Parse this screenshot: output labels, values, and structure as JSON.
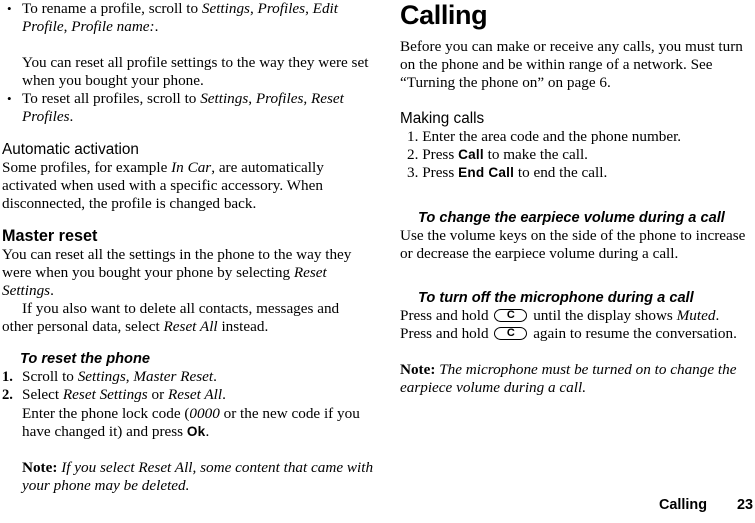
{
  "document": {
    "type": "phone-user-manual-page",
    "page_number": "23",
    "footer_chapter": "Calling"
  },
  "left_column": {
    "bullets": [
      {
        "marker": "•",
        "text_parts": [
          {
            "t": "To rename a profile, scroll to ",
            "style": "normal"
          },
          {
            "t": "Settings",
            "style": "italic"
          },
          {
            "t": ", ",
            "style": "normal"
          },
          {
            "t": "Profiles",
            "style": "italic"
          },
          {
            "t": ", ",
            "style": "normal"
          },
          {
            "t": "Edit Profile",
            "style": "italic"
          },
          {
            "t": ", ",
            "style": "normal"
          },
          {
            "t": "Profile name:",
            "style": "italic"
          },
          {
            "t": ".",
            "style": "normal"
          }
        ]
      }
    ],
    "intro_paragraph": "You can reset all profile settings to the way they were set when you bought your phone.",
    "bullet2": {
      "marker": "•",
      "text_parts": [
        {
          "t": "To reset all profiles, scroll to ",
          "style": "normal"
        },
        {
          "t": "Settings",
          "style": "italic"
        },
        {
          "t": ", ",
          "style": "normal"
        },
        {
          "t": "Profiles",
          "style": "italic"
        },
        {
          "t": ", ",
          "style": "normal"
        },
        {
          "t": "Reset Profiles",
          "style": "italic"
        },
        {
          "t": ".",
          "style": "normal"
        }
      ]
    },
    "automatic_activation": {
      "heading": "Automatic activation",
      "body_pre": "Some profiles, for example ",
      "body_italic": "In Car",
      "body_post": ", are automatically activated when used with a specific accessory. When disconnected, the profile is changed back."
    },
    "master_reset": {
      "heading": "Master reset",
      "body_pre": "You can reset all the settings in the phone to the way they were when you bought your phone by selecting ",
      "body_italic": "Reset Settings",
      "body_post": ".",
      "body2_pre": "If you also want to delete all contacts, messages and other personal data, select ",
      "body2_italic": "Reset All",
      "body2_post": " instead."
    },
    "to_reset_the_phone": {
      "heading": "To reset the phone",
      "steps": [
        {
          "num": "1.",
          "parts": [
            {
              "t": "Scroll to ",
              "style": "normal"
            },
            {
              "t": "Settings",
              "style": "italic"
            },
            {
              "t": ", ",
              "style": "normal"
            },
            {
              "t": "Master Reset",
              "style": "italic"
            },
            {
              "t": ".",
              "style": "normal"
            }
          ]
        },
        {
          "num": "2.",
          "parts": [
            {
              "t": "Select ",
              "style": "normal"
            },
            {
              "t": "Reset Settings",
              "style": "italic"
            },
            {
              "t": " or ",
              "style": "normal"
            },
            {
              "t": "Reset All",
              "style": "italic"
            },
            {
              "t": ".",
              "style": "normal"
            }
          ]
        }
      ],
      "step2_continuation": {
        "pre": "Enter the phone lock code (",
        "code": "0000",
        "mid": " or the new code if you have changed it) and press ",
        "key": "Ok",
        "post": "."
      }
    },
    "note": {
      "label": "Note:",
      "text": "If you select Reset All, some content that came with your phone may be deleted."
    }
  },
  "right_column": {
    "chapter_title": "Calling",
    "intro": "Before you can make or receive any calls, you must turn on the phone and be within range of a network. See “Turning the phone on” on page 6.",
    "making_calls": {
      "heading": "Making calls",
      "steps": [
        {
          "num": "1.",
          "parts": [
            {
              "t": "Enter the area code and the phone number.",
              "style": "normal"
            }
          ]
        },
        {
          "num": "2.",
          "parts": [
            {
              "t": "Press ",
              "style": "normal"
            },
            {
              "t": "Call",
              "style": "key"
            },
            {
              "t": " to make the call.",
              "style": "normal"
            }
          ]
        },
        {
          "num": "3.",
          "parts": [
            {
              "t": "Press ",
              "style": "normal"
            },
            {
              "t": "End Call",
              "style": "key"
            },
            {
              "t": " to end the call.",
              "style": "normal"
            }
          ]
        }
      ]
    },
    "change_volume": {
      "heading": "To change the earpiece volume during a call",
      "body": "Use the volume keys on the side of the phone to increase or decrease the earpiece volume during a call."
    },
    "mute_mic": {
      "heading": "To turn off the microphone during a call",
      "line1_pre": "Press and hold ",
      "line1_key": "C",
      "line1_mid": " until the display shows ",
      "line1_italic": "Muted",
      "line1_post": ".",
      "line2_pre": "Press and hold ",
      "line2_key": "C",
      "line2_post": " again to resume the conversation."
    },
    "note": {
      "label": "Note:",
      "text": "The microphone must be turned on to change the earpiece volume during a call."
    }
  }
}
